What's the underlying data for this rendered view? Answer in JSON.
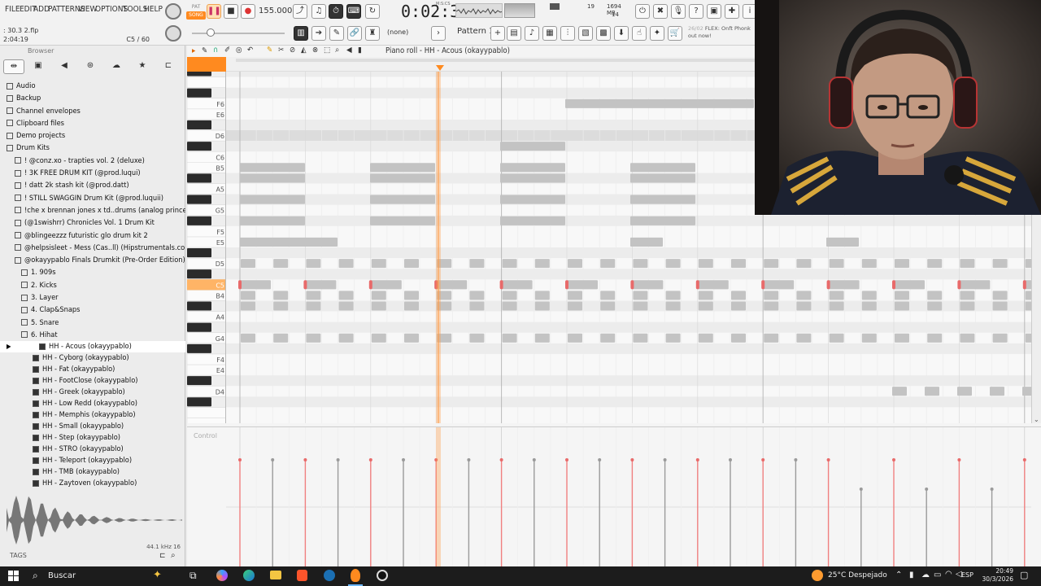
{
  "menu": {
    "items": [
      "FILE",
      "EDIT",
      "ADD",
      "PATTERNS",
      "VIEW",
      "OPTIONS",
      "TOOLS",
      "HELP"
    ]
  },
  "transport": {
    "mode_pat": "PAT",
    "mode_song": "SONG",
    "tempo": "155.000",
    "time": "0:02:37",
    "time_unit": "M:S:CS",
    "cpu_line1": "19",
    "cpu_line2": "14",
    "mem": "1694 MB"
  },
  "hint": {
    "file": ": 30.3 2.flp",
    "time": "2:04:19",
    "pos": "C5 / 60"
  },
  "toolbar2": {
    "pattern_label": "Pattern 1",
    "none_label": "(none)",
    "news_date": "26/02",
    "news_text": "FLEX: Onft Phonk",
    "news_text2": "out now!"
  },
  "browser": {
    "title": "Browser",
    "tree": [
      {
        "label": "Audio",
        "indent": 0
      },
      {
        "label": "Backup",
        "indent": 0
      },
      {
        "label": "Channel envelopes",
        "indent": 0
      },
      {
        "label": "Clipboard files",
        "indent": 0
      },
      {
        "label": "Demo projects",
        "indent": 0
      },
      {
        "label": "Drum Kits",
        "indent": 0
      },
      {
        "label": "! @conz.xo - trapties vol. 2 (deluxe)",
        "indent": 1
      },
      {
        "label": "! 3K FREE DRUM KIT (@prod.luqui)",
        "indent": 1
      },
      {
        "label": "! datt 2k stash kit (@prod.datt)",
        "indent": 1
      },
      {
        "label": "! STILL SWAGGIN Drum Kit (@prod.luquii)",
        "indent": 1
      },
      {
        "label": "!che x brennan jones x td..drums (analog princess)",
        "indent": 1
      },
      {
        "label": "(@1swishrr) Chronicles Vol. 1 Drum Kit",
        "indent": 1
      },
      {
        "label": "@blingeezzz futuristic glo drum kit 2",
        "indent": 1
      },
      {
        "label": "@helpsisleet - Mess (Cas..ll) (Hipstrumentals.com)",
        "indent": 1
      },
      {
        "label": "@okayypablo Finals Drumkit (Pre-Order Edition)",
        "indent": 1
      },
      {
        "label": "1. 909s",
        "indent": 2
      },
      {
        "label": "2. Kicks",
        "indent": 2
      },
      {
        "label": "3. Layer",
        "indent": 2
      },
      {
        "label": "4. Clap&Snaps",
        "indent": 2
      },
      {
        "label": "5. Snare",
        "indent": 2
      },
      {
        "label": "6. Hihat",
        "indent": 2
      }
    ],
    "files": [
      "HH - Acous (okayypablo)",
      "HH - Cyborg (okayypablo)",
      "HH - Fat (okayypablo)",
      "HH - FootClose (okayypablo)",
      "HH - Greek (okayypablo)",
      "HH - Low Redd (okayypablo)",
      "HH - Memphis (okayypablo)",
      "HH - Small (okayypablo)",
      "HH - Step (okayypablo)",
      "HH - STRO (okayypablo)",
      "HH - Teleport (okayypablo)",
      "HH - TMB (okayypablo)",
      "HH - Zaytoven (okayypablo)"
    ],
    "sample_info": "44.1 kHz 16",
    "tags_label": "TAGS"
  },
  "pianoroll": {
    "title": "Piano roll - HH - Acous (okayypablo)",
    "control_label": "Control",
    "note_labels": [
      "F6",
      "E6",
      "D6",
      "C6",
      "B5",
      "A5",
      "G5",
      "F5",
      "E5",
      "D5",
      "C5",
      "B4",
      "A4",
      "G4",
      "F4",
      "E4",
      "D4"
    ]
  },
  "taskbar": {
    "search": "Buscar",
    "weather": "25°C  Despejado",
    "lang": "ESP",
    "time": "20:49",
    "date": "30/3/2026"
  },
  "colors": {
    "accent": "#ff8a1f",
    "note": "#c3c3c3",
    "note_active": "#e86a6a",
    "playhead": "#ff9a44"
  }
}
